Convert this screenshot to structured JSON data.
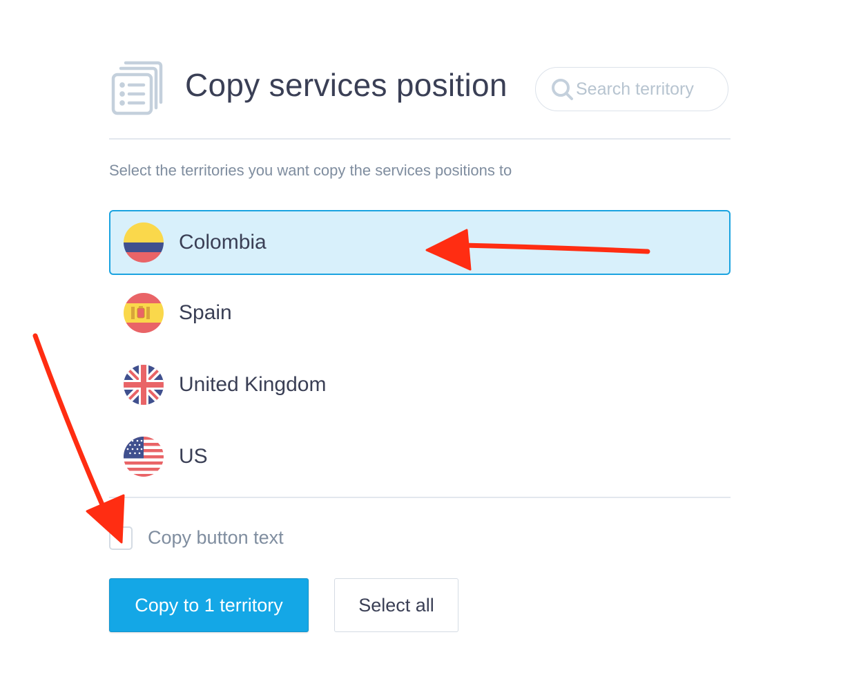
{
  "header": {
    "icon": "document-list-icon",
    "title": "Copy services position",
    "search": {
      "icon": "search-icon",
      "placeholder": "Search territory",
      "value": ""
    }
  },
  "subtitle": "Select the territories you want copy the services positions to",
  "territories": [
    {
      "label": "Colombia",
      "flag": "colombia-flag-icon",
      "selected": true
    },
    {
      "label": "Spain",
      "flag": "spain-flag-icon",
      "selected": false
    },
    {
      "label": "United Kingdom",
      "flag": "united-kingdom-flag-icon",
      "selected": false
    },
    {
      "label": "US",
      "flag": "us-flag-icon",
      "selected": false
    }
  ],
  "copy_button_text": {
    "label": "Copy button text",
    "checked": false
  },
  "actions": {
    "primary_label": "Copy to 1 territory",
    "secondary_label": "Select all"
  },
  "colors": {
    "accent": "#14a7e6",
    "selected_background": "#d8f0fb",
    "selected_border": "#1aa3e0",
    "title_text": "#3a3f55",
    "muted_text": "#7f8d9f",
    "annotation_arrow": "#ff2d12"
  },
  "annotations": [
    {
      "type": "arrow",
      "points_to": "Colombia"
    },
    {
      "type": "arrow",
      "points_to": "Copy button text"
    }
  ]
}
